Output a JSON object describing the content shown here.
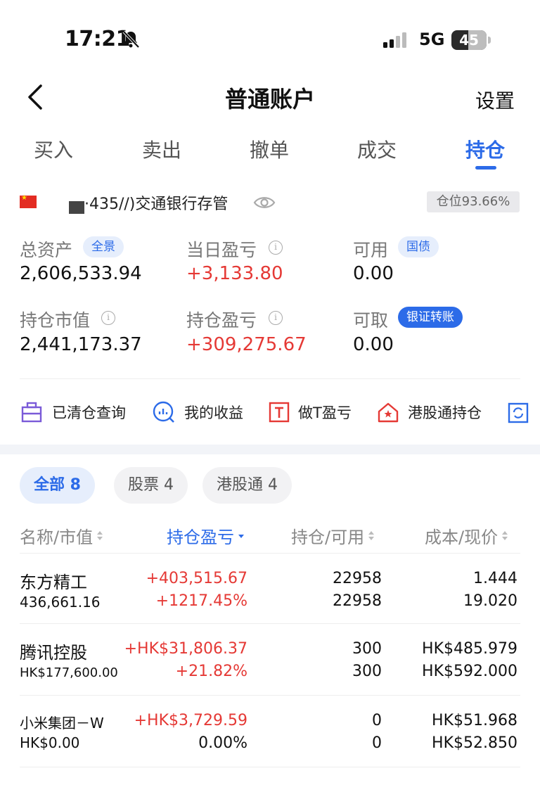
{
  "status_bar": {
    "time": "17:21",
    "network": "5G",
    "battery": "45"
  },
  "header": {
    "title": "普通账户",
    "settings": "设置"
  },
  "tabs": [
    "买入",
    "卖出",
    "撤单",
    "成交",
    "持仓"
  ],
  "account": {
    "name": "·435//)交通银行存管",
    "position_ratio": "仓位93.66%"
  },
  "summary": {
    "total_assets_label": "总资产",
    "total_assets_tag": "全景",
    "total_assets": "2,606,533.94",
    "daily_pl_label": "当日盈亏",
    "daily_pl": "+3,133.80",
    "available_label": "可用",
    "available_tag": "国债",
    "available": "0.00",
    "market_value_label": "持仓市值",
    "market_value": "2,441,173.37",
    "position_pl_label": "持仓盈亏",
    "position_pl": "+309,275.67",
    "withdrawable_label": "可取",
    "withdrawable_tag": "银证转账",
    "withdrawable": "0.00"
  },
  "quick_actions": [
    "已清仓查询",
    "我的收益",
    "做T盈亏",
    "港股通持仓"
  ],
  "filters": [
    "全部 8",
    "股票 4",
    "港股通 4"
  ],
  "table": {
    "headers": [
      "名称/市值",
      "持仓盈亏",
      "持仓/可用",
      "成本/现价"
    ],
    "rows": [
      {
        "name": "东方精工",
        "value": "436,661.16",
        "pl": "+403,515.67",
        "pl_pct": "+1217.45%",
        "hold": "22958",
        "avail": "22958",
        "cost": "1.444",
        "price": "19.020"
      },
      {
        "name": "腾讯控股",
        "value": "HK$177,600.00",
        "pl": "+HK$31,806.37",
        "pl_pct": "+21.82%",
        "hold": "300",
        "avail": "300",
        "cost": "HK$485.979",
        "price": "HK$592.000"
      },
      {
        "name": "小米集团－W",
        "value": "HK$0.00",
        "pl": "+HK$3,729.59",
        "pl_pct": "0.00%",
        "hold": "0",
        "avail": "0",
        "cost": "HK$51.968",
        "price": "HK$52.850"
      }
    ]
  },
  "colors": {
    "accent": "#2c6be8",
    "gain": "#e53935"
  }
}
